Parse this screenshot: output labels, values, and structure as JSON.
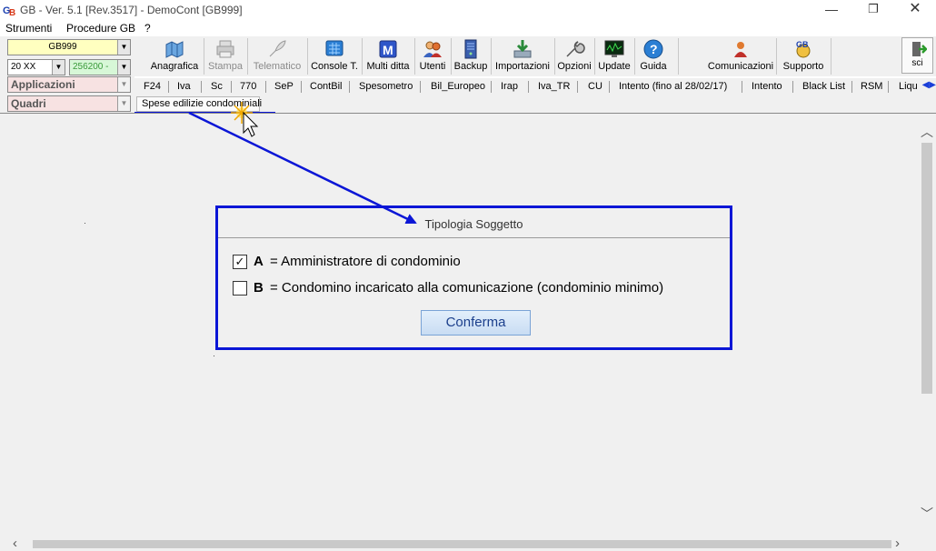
{
  "window": {
    "title": "GB - Ver. 5.1 [Rev.3517] -  DemoCont [GB999]",
    "controls": {
      "minimize": "—",
      "maximize": "❐",
      "close": "✕"
    }
  },
  "menu": [
    "Strumenti",
    "Procedure GB",
    "?"
  ],
  "left": {
    "ditta": "GB999",
    "year": "20 XX",
    "conto": "256200 -",
    "applicazioni": "Applicazioni",
    "quadri": "Quadri"
  },
  "toolbar": [
    {
      "label": "Anagrafica",
      "icon": "map-icon",
      "disabled": false
    },
    {
      "label": "Stampa",
      "icon": "printer-icon",
      "disabled": true
    },
    {
      "label": "Telematico",
      "icon": "quill-icon",
      "disabled": true
    },
    {
      "label": "Console T.",
      "icon": "console-icon",
      "disabled": false
    },
    {
      "label": "Multi ditta",
      "icon": "multi-ditta-icon",
      "disabled": false
    },
    {
      "label": "Utenti",
      "icon": "users-icon",
      "disabled": false
    },
    {
      "label": "Backup",
      "icon": "server-icon",
      "disabled": false
    },
    {
      "label": "Importazioni",
      "icon": "import-icon",
      "disabled": false
    },
    {
      "label": "Opzioni",
      "icon": "wrench-icon",
      "disabled": false
    },
    {
      "label": "Update",
      "icon": "monitor-icon",
      "disabled": false
    },
    {
      "label": "Guida",
      "icon": "help-icon",
      "disabled": false
    },
    {
      "label": "Comunicazioni",
      "icon": "communications-icon",
      "disabled": false
    },
    {
      "label": "Supporto",
      "icon": "support-icon",
      "disabled": false
    }
  ],
  "exit_button": {
    "label": "sci",
    "icon": "exit-icon"
  },
  "app_tabs": [
    "F24",
    "Iva",
    "Sc",
    "770",
    "SeP",
    "ContBil",
    "Spesometro",
    "Bil_Europeo",
    "Irap",
    "Iva_TR",
    "CU",
    "Intento (fino al 28/02/17)",
    "Intento",
    "Black List",
    "RSM",
    "Liqu"
  ],
  "quadri_tab": "Spese edilizie condominiali",
  "dialog": {
    "title": "Tipologia Soggetto",
    "options": [
      {
        "key": "A",
        "text": "= Amministratore di condominio",
        "checked": true
      },
      {
        "key": "B",
        "text": "= Condomino incaricato alla comunicazione (condominio minimo)",
        "checked": false
      }
    ],
    "confirm_label": "Conferma"
  },
  "colors": {
    "annotation_blue": "#0b16d6",
    "ditta_bg": "#ffffc0",
    "conto_bg": "#d7f7d7",
    "selector_bg": "#f7e2e2"
  }
}
